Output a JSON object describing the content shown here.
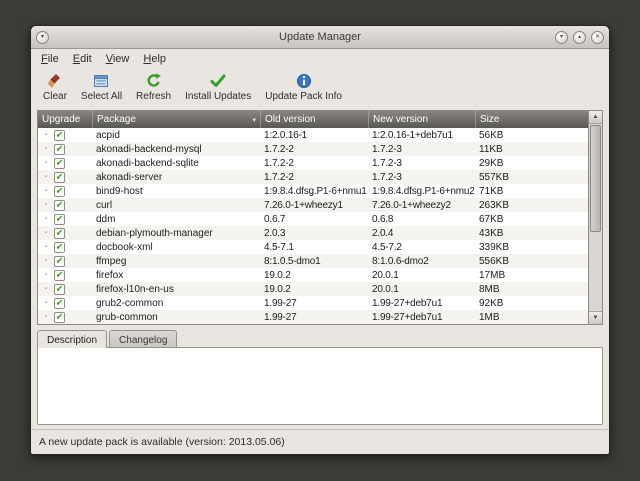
{
  "window": {
    "title": "Update Manager",
    "controls": {
      "menu_glyph": "▾",
      "minimize_glyph": "▾",
      "maximize_glyph": "▴",
      "close_glyph": "✕"
    }
  },
  "menubar": {
    "items": [
      {
        "label": "File"
      },
      {
        "label": "Edit"
      },
      {
        "label": "View"
      },
      {
        "label": "Help"
      }
    ]
  },
  "toolbar": {
    "buttons": [
      {
        "label": "Clear"
      },
      {
        "label": "Select All"
      },
      {
        "label": "Refresh"
      },
      {
        "label": "Install Updates"
      },
      {
        "label": "Update Pack Info"
      }
    ]
  },
  "table": {
    "columns": [
      "Upgrade",
      "Package",
      "Old version",
      "New version",
      "Size"
    ],
    "sort_glyph": "▾",
    "tree_glyph": "-",
    "check_glyph": "✔",
    "rows": [
      {
        "checked": true,
        "package": "acpid",
        "old_version": "1:2.0.16-1",
        "new_version": "1:2.0.16-1+deb7u1",
        "size": "56KB"
      },
      {
        "checked": true,
        "package": "akonadi-backend-mysql",
        "old_version": "1.7.2-2",
        "new_version": "1.7.2-3",
        "size": "11KB"
      },
      {
        "checked": true,
        "package": "akonadi-backend-sqlite",
        "old_version": "1.7.2-2",
        "new_version": "1.7.2-3",
        "size": "29KB"
      },
      {
        "checked": true,
        "package": "akonadi-server",
        "old_version": "1.7.2-2",
        "new_version": "1.7.2-3",
        "size": "557KB"
      },
      {
        "checked": true,
        "package": "bind9-host",
        "old_version": "1:9.8.4.dfsg.P1-6+nmu1",
        "new_version": "1:9.8.4.dfsg.P1-6+nmu2",
        "size": "71KB"
      },
      {
        "checked": true,
        "package": "curl",
        "old_version": "7.26.0-1+wheezy1",
        "new_version": "7.26.0-1+wheezy2",
        "size": "263KB"
      },
      {
        "checked": true,
        "package": "ddm",
        "old_version": "0.6.7",
        "new_version": "0.6.8",
        "size": "67KB"
      },
      {
        "checked": true,
        "package": "debian-plymouth-manager",
        "old_version": "2.0.3",
        "new_version": "2.0.4",
        "size": "43KB"
      },
      {
        "checked": true,
        "package": "docbook-xml",
        "old_version": "4.5-7.1",
        "new_version": "4.5-7.2",
        "size": "339KB"
      },
      {
        "checked": true,
        "package": "ffmpeg",
        "old_version": "8:1.0.5-dmo1",
        "new_version": "8:1.0.6-dmo2",
        "size": "556KB"
      },
      {
        "checked": true,
        "package": "firefox",
        "old_version": "19.0.2",
        "new_version": "20.0.1",
        "size": "17MB"
      },
      {
        "checked": true,
        "package": "firefox-l10n-en-us",
        "old_version": "19.0.2",
        "new_version": "20.0.1",
        "size": "8MB"
      },
      {
        "checked": true,
        "package": "grub2-common",
        "old_version": "1.99-27",
        "new_version": "1.99-27+deb7u1",
        "size": "92KB"
      },
      {
        "checked": true,
        "package": "grub-common",
        "old_version": "1.99-27",
        "new_version": "1.99-27+deb7u1",
        "size": "1MB"
      }
    ]
  },
  "scrollbar": {
    "up_glyph": "▲",
    "down_glyph": "▼"
  },
  "tabs": [
    {
      "label": "Description",
      "active": true
    },
    {
      "label": "Changelog",
      "active": false
    }
  ],
  "statusbar": {
    "text": "A new update pack is available (version: 2013.05.06)"
  }
}
